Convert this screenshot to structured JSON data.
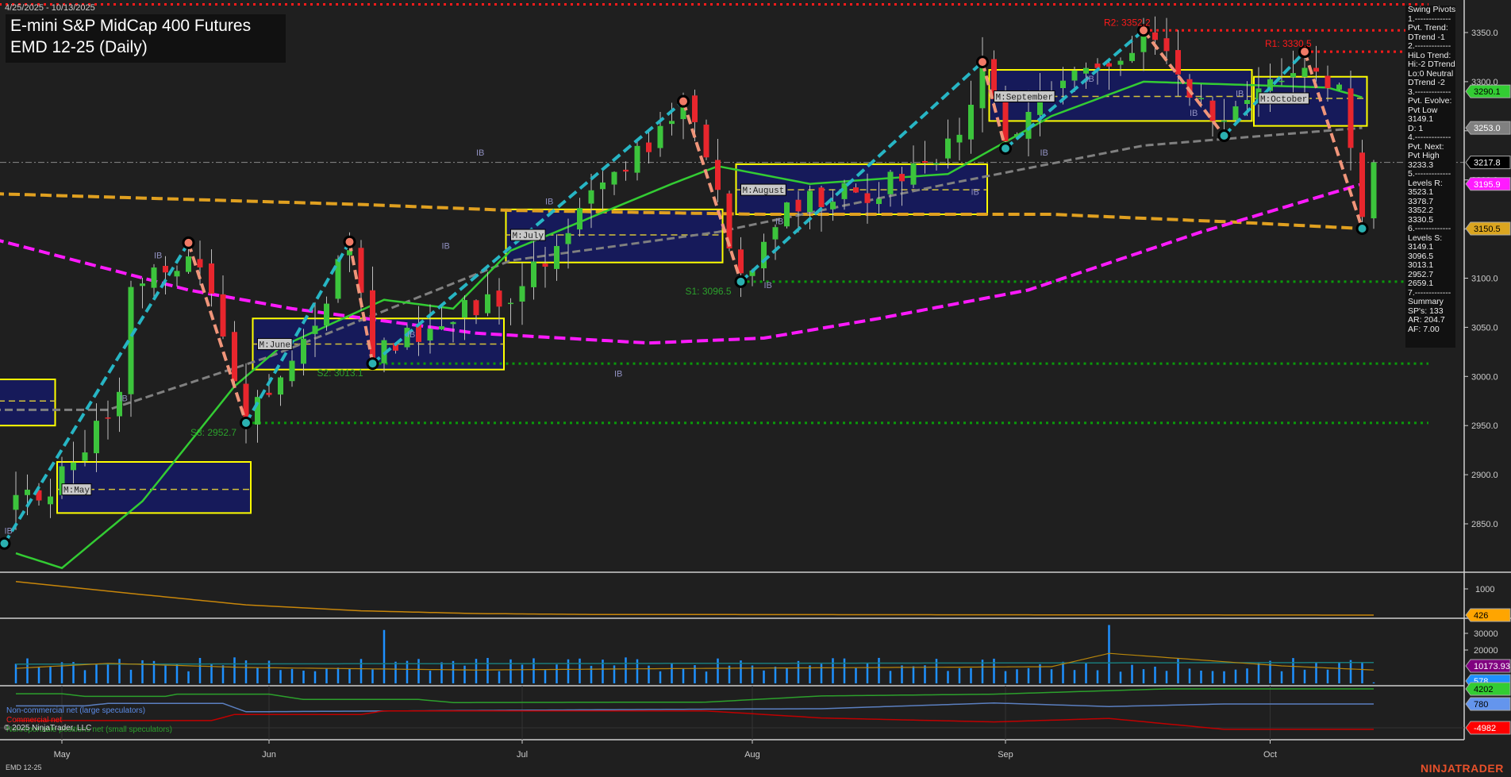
{
  "header": {
    "date_range": "4/25/2025 - 10/13/2025",
    "title_line1": "E-mini S&P MidCap 400 Futures",
    "title_line2": "EMD 12-25 (Daily)"
  },
  "info_panel": {
    "lines": [
      "Swing Pivots",
      "1.-------------",
      "Pvt. Trend:",
      "DTrend -1",
      "2.-------------",
      "HiLo Trend:",
      "Hi:-2 DTrend",
      "Lo:0 Neutral",
      "DTrend -2",
      "3.-------------",
      "Pvt. Evolve:",
      "Pvt Low",
      "3149.1",
      "D: 1",
      "4.-------------",
      "Pvt. Next:",
      "Pvt High",
      "3233.3",
      "5.-------------",
      "Levels R:",
      "3523.1",
      "3378.7",
      "3352.2",
      "3330.5",
      "6.-------------",
      "Levels S:",
      "3149.1",
      "3096.5",
      "3013.1",
      "2952.7",
      "2659.1",
      "7.-------------",
      "Summary",
      "SP's: 133",
      "AR: 204.7",
      "AF: 7.00"
    ]
  },
  "legend": {
    "noncommercial": "Non-commercial net (large speculators)",
    "commercial": "Commercial net",
    "nonreportable": "Nonreportable positions net (small speculators)",
    "copyright": "© 2025 NinjaTrader, LLC"
  },
  "footer": {
    "instrument": "EMD 12-25",
    "brand": "NINJATRADER"
  },
  "colors": {
    "up": "#3cc43c",
    "down": "#e8262d",
    "pivot_up": "#27b5c4",
    "pivot_down": "#f0957a",
    "resistance": "#ff1a1a",
    "support": "#0a9a0a",
    "ma_fast": "#33cc33",
    "ma_mid": "#808080",
    "ma_magenta": "#ff1aff",
    "ma_gold": "#e0a020",
    "box_fill": "#161a5a",
    "box_border": "#ffff00"
  },
  "chart_data": {
    "type": "candlestick",
    "bar_count": 119,
    "close_anchors": [
      [
        0,
        2870
      ],
      [
        3,
        2880
      ],
      [
        6,
        2930
      ],
      [
        9,
        2990
      ],
      [
        10,
        3080
      ],
      [
        13,
        3110
      ],
      [
        15,
        3130
      ],
      [
        17,
        3090
      ],
      [
        20,
        2960
      ],
      [
        23,
        3010
      ],
      [
        26,
        3060
      ],
      [
        29,
        3130
      ],
      [
        31,
        3020
      ],
      [
        35,
        3050
      ],
      [
        40,
        3070
      ],
      [
        44,
        3090
      ],
      [
        48,
        3160
      ],
      [
        52,
        3210
      ],
      [
        56,
        3250
      ],
      [
        58,
        3275
      ],
      [
        60,
        3230
      ],
      [
        63,
        3100
      ],
      [
        66,
        3160
      ],
      [
        70,
        3180
      ],
      [
        75,
        3190
      ],
      [
        80,
        3210
      ],
      [
        84,
        3310
      ],
      [
        86,
        3235
      ],
      [
        90,
        3290
      ],
      [
        94,
        3310
      ],
      [
        98,
        3345
      ],
      [
        102,
        3290
      ],
      [
        105,
        3250
      ],
      [
        109,
        3300
      ],
      [
        112,
        3325
      ],
      [
        115,
        3290
      ],
      [
        117,
        3160
      ],
      [
        118,
        3217.8
      ]
    ],
    "months": [
      {
        "label": "May",
        "bar": 4
      },
      {
        "label": "Jun",
        "bar": 22
      },
      {
        "label": "Jul",
        "bar": 44
      },
      {
        "label": "Aug",
        "bar": 64
      },
      {
        "label": "Sep",
        "bar": 86
      },
      {
        "label": "Oct",
        "bar": 109
      }
    ],
    "y_axis": {
      "min": 2820,
      "max": 3380,
      "ticks": [
        "3350.0",
        "3300.0",
        "3250.0",
        "3200.0",
        "3150.0",
        "3100.0",
        "3050.0",
        "3000.0",
        "2950.0",
        "2900.0",
        "2850.0"
      ]
    },
    "swing_pivots": [
      {
        "bar": -1,
        "price": 2830,
        "type": "low"
      },
      {
        "bar": 15,
        "price": 3136,
        "type": "high"
      },
      {
        "bar": 20,
        "price": 2952.7,
        "type": "low"
      },
      {
        "bar": 29,
        "price": 3137,
        "type": "high"
      },
      {
        "bar": 31,
        "price": 3013.1,
        "type": "low"
      },
      {
        "bar": 58,
        "price": 3280,
        "type": "high"
      },
      {
        "bar": 63,
        "price": 3096.5,
        "type": "low"
      },
      {
        "bar": 84,
        "price": 3320,
        "type": "high"
      },
      {
        "bar": 86,
        "price": 3232,
        "type": "low"
      },
      {
        "bar": 98,
        "price": 3352.2,
        "type": "high"
      },
      {
        "bar": 105,
        "price": 3245,
        "type": "low"
      },
      {
        "bar": 112,
        "price": 3330.5,
        "type": "high"
      },
      {
        "bar": 117,
        "price": 3150.5,
        "type": "low"
      }
    ],
    "levels": [
      {
        "label": "R2: 3352.2",
        "price": 3352.2,
        "from": 98,
        "kind": "resistance"
      },
      {
        "label": "R1: 3330.5",
        "price": 3330.5,
        "from": 112,
        "kind": "resistance"
      },
      {
        "label": "",
        "price": 3378.7,
        "from": -2,
        "kind": "resistance"
      },
      {
        "label": "S1: 3096.5",
        "price": 3096.5,
        "from": 63,
        "kind": "support"
      },
      {
        "label": "S2: 3013.1",
        "price": 3013.1,
        "from": 31,
        "kind": "support"
      },
      {
        "label": "S3: 2952.7",
        "price": 2952.7,
        "from": 20,
        "kind": "support"
      }
    ],
    "last_price_line": 3217.8,
    "monthly_boxes": [
      {
        "label": "",
        "start": -2,
        "end": 3,
        "low": 2950,
        "high": 2997,
        "mid": 2975
      },
      {
        "label": "M:May",
        "start": 4,
        "end": 20,
        "low": 2861,
        "high": 2913,
        "mid": 2885
      },
      {
        "label": "M:June",
        "start": 21,
        "end": 42,
        "low": 3007,
        "high": 3059,
        "mid": 3033
      },
      {
        "label": "M:July",
        "start": 43,
        "end": 61,
        "low": 3116,
        "high": 3170,
        "mid": 3144
      },
      {
        "label": "M:August",
        "start": 63,
        "end": 84,
        "low": 3165,
        "high": 3216,
        "mid": 3190
      },
      {
        "label": "M:September",
        "start": 85,
        "end": 107,
        "low": 3260,
        "high": 3312,
        "mid": 3285
      },
      {
        "label": "M:October",
        "start": 108,
        "end": 117,
        "low": 3255,
        "high": 3305,
        "mid": 3283
      }
    ],
    "ib_labels": [
      {
        "bar": 12,
        "price": 3120
      },
      {
        "bar": 9,
        "price": 2975
      },
      {
        "bar": -1,
        "price": 2840
      },
      {
        "bar": 34,
        "price": 3040
      },
      {
        "bar": 37,
        "price": 3130
      },
      {
        "bar": 40,
        "price": 3225
      },
      {
        "bar": 52,
        "price": 3000
      },
      {
        "bar": 46,
        "price": 3175
      },
      {
        "bar": 66,
        "price": 3155
      },
      {
        "bar": 65,
        "price": 3090
      },
      {
        "bar": 83,
        "price": 3185
      },
      {
        "bar": 89,
        "price": 3225
      },
      {
        "bar": 93,
        "price": 3300
      },
      {
        "bar": 102,
        "price": 3265
      },
      {
        "bar": 106,
        "price": 3285
      }
    ],
    "ma_fast": [
      [
        0,
        2820
      ],
      [
        4,
        2805
      ],
      [
        11,
        2873
      ],
      [
        19,
        2990
      ],
      [
        23,
        3030
      ],
      [
        32,
        3078
      ],
      [
        38,
        3069
      ],
      [
        43,
        3128
      ],
      [
        57,
        3196
      ],
      [
        61,
        3214
      ],
      [
        69,
        3196
      ],
      [
        81,
        3206
      ],
      [
        90,
        3265
      ],
      [
        98,
        3300
      ],
      [
        114,
        3294
      ],
      [
        117,
        3284
      ]
    ],
    "ma_gray": [
      [
        -2,
        2966
      ],
      [
        8,
        2966
      ],
      [
        22,
        3020
      ],
      [
        43,
        3118
      ],
      [
        61,
        3147
      ],
      [
        81,
        3196
      ],
      [
        98,
        3235
      ],
      [
        117,
        3253
      ]
    ],
    "ma_magenta": [
      [
        -2,
        3140
      ],
      [
        15,
        3088
      ],
      [
        24,
        3069
      ],
      [
        40,
        3044
      ],
      [
        55,
        3034
      ],
      [
        65,
        3039
      ],
      [
        75,
        3059
      ],
      [
        88,
        3088
      ],
      [
        103,
        3147
      ],
      [
        117,
        3195.9
      ]
    ],
    "ma_gold": [
      [
        -2,
        3186
      ],
      [
        30,
        3175
      ],
      [
        43,
        3169
      ],
      [
        65,
        3165
      ],
      [
        90,
        3165
      ],
      [
        106,
        3157
      ],
      [
        117,
        3150.5
      ]
    ],
    "price_tags": [
      {
        "value": "3290.1",
        "color": "#33cc33",
        "text": "#000",
        "price": 3290.1
      },
      {
        "value": "3253.0",
        "color": "#808080",
        "text": "#fff",
        "price": 3253
      },
      {
        "value": "3217.8",
        "color": "#000000",
        "text": "#fff",
        "price": 3217.8
      },
      {
        "value": "3195.9",
        "color": "#ff1aff",
        "text": "#fff",
        "price": 3195.9
      },
      {
        "value": "3150.5",
        "color": "#daa520",
        "text": "#000",
        "price": 3150.5
      }
    ],
    "panel_open_interest": {
      "ticks": [
        "1000"
      ],
      "last": "426",
      "line": [
        [
          0,
          1160
        ],
        [
          10,
          900
        ],
        [
          20,
          650
        ],
        [
          30,
          520
        ],
        [
          40,
          460
        ],
        [
          50,
          440
        ],
        [
          118,
          426
        ]
      ]
    },
    "panel_volume": {
      "ticks": [
        "30000",
        "20000"
      ],
      "last_avg": "10173.93",
      "last_volume": "578",
      "spikes": [
        [
          32,
          32000
        ],
        [
          95,
          35000
        ]
      ]
    },
    "panel_cot": {
      "last_large": "780",
      "last_commercial": "-4982",
      "last_small": "4202",
      "small": [
        [
          0,
          3100
        ],
        [
          4,
          3100
        ],
        [
          6,
          2500
        ],
        [
          13,
          2500
        ],
        [
          14,
          3000
        ],
        [
          22,
          3000
        ],
        [
          25,
          1800
        ],
        [
          35,
          1800
        ],
        [
          38,
          1100
        ],
        [
          60,
          1200
        ],
        [
          70,
          2600
        ],
        [
          85,
          3000
        ],
        [
          100,
          4202
        ],
        [
          118,
          4202
        ]
      ],
      "large": [
        [
          0,
          350
        ],
        [
          6,
          350
        ],
        [
          8,
          900
        ],
        [
          18,
          900
        ],
        [
          20,
          -1000
        ],
        [
          40,
          -700
        ],
        [
          60,
          -400
        ],
        [
          70,
          -300
        ],
        [
          85,
          1000
        ],
        [
          95,
          200
        ],
        [
          105,
          780
        ],
        [
          118,
          780
        ]
      ],
      "commercial": [
        [
          0,
          -3000
        ],
        [
          17,
          -3000
        ],
        [
          19,
          -1600
        ],
        [
          30,
          -1600
        ],
        [
          32,
          -800
        ],
        [
          60,
          -800
        ],
        [
          70,
          -2400
        ],
        [
          85,
          -3300
        ],
        [
          95,
          -2500
        ],
        [
          105,
          -4982
        ],
        [
          118,
          -4982
        ]
      ]
    }
  }
}
